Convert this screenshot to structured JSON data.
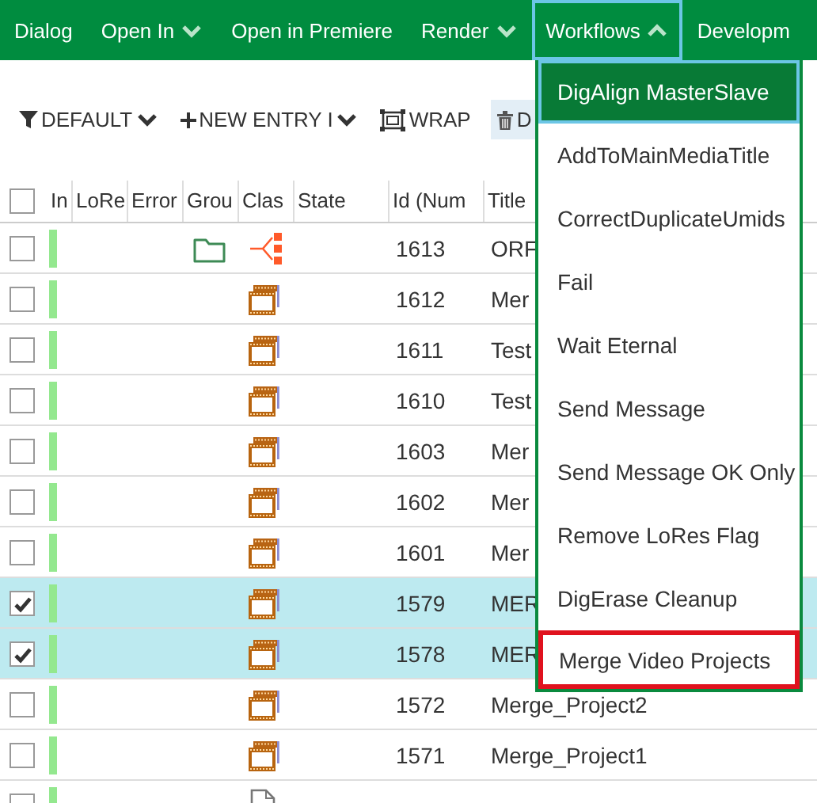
{
  "menubar": {
    "items": [
      {
        "label": "Dialog",
        "kind": "plain",
        "expanded": false
      },
      {
        "label": "Open In",
        "kind": "dropdown",
        "expanded": false
      },
      {
        "label": "Open in Premiere",
        "kind": "plain",
        "expanded": false
      },
      {
        "label": "Render",
        "kind": "dropdown",
        "expanded": false
      },
      {
        "label": "Workflows",
        "kind": "dropdown",
        "expanded": true
      },
      {
        "label": "Developm",
        "kind": "plain",
        "expanded": false
      }
    ]
  },
  "toolbar": {
    "items": [
      {
        "kind": "filter",
        "label": "DEFAULT"
      },
      {
        "kind": "new",
        "label": "NEW ENTRY I"
      },
      {
        "kind": "wrap",
        "label": "WRAP"
      },
      {
        "kind": "delete",
        "label": "D"
      }
    ]
  },
  "table": {
    "select_all": {
      "checked": false
    },
    "columns": [
      "In",
      "LoRe",
      "Error",
      "Grou",
      "Clas",
      "State",
      "Id (Num",
      "Title"
    ],
    "rows": [
      {
        "kind": "sequence",
        "group": true,
        "id": "1613",
        "title": "ORF",
        "checked": false,
        "selected": false
      },
      {
        "kind": "clip",
        "group": false,
        "id": "1612",
        "title": "Mer",
        "checked": false,
        "selected": false
      },
      {
        "kind": "clip",
        "group": false,
        "id": "1611",
        "title": "Test",
        "checked": false,
        "selected": false
      },
      {
        "kind": "clip",
        "group": false,
        "id": "1610",
        "title": "Test",
        "checked": false,
        "selected": false
      },
      {
        "kind": "clip",
        "group": false,
        "id": "1603",
        "title": "Mer",
        "checked": false,
        "selected": false
      },
      {
        "kind": "clip",
        "group": false,
        "id": "1602",
        "title": "Mer",
        "checked": false,
        "selected": false
      },
      {
        "kind": "clip",
        "group": false,
        "id": "1601",
        "title": "Mer",
        "checked": false,
        "selected": false
      },
      {
        "kind": "clip",
        "group": false,
        "id": "1579",
        "title": "MER",
        "checked": true,
        "selected": true
      },
      {
        "kind": "clip",
        "group": false,
        "id": "1578",
        "title": "MER",
        "checked": true,
        "selected": true
      },
      {
        "kind": "clip",
        "group": false,
        "id": "1572",
        "title": "Merge_Project2",
        "checked": false,
        "selected": false
      },
      {
        "kind": "clip",
        "group": false,
        "id": "1571",
        "title": "Merge_Project1",
        "checked": false,
        "selected": false
      },
      {
        "kind": "document",
        "group": false,
        "checked": false,
        "selected": false
      }
    ]
  },
  "workflows_menu": {
    "items": [
      {
        "label": "DigAlign MasterSlave",
        "selected": true,
        "outlined": false
      },
      {
        "label": "AddToMainMediaTitle",
        "selected": false,
        "outlined": false
      },
      {
        "label": "CorrectDuplicateUmids",
        "selected": false,
        "outlined": false
      },
      {
        "label": "Fail",
        "selected": false,
        "outlined": false
      },
      {
        "label": "Wait Eternal",
        "selected": false,
        "outlined": false
      },
      {
        "label": "Send Message",
        "selected": false,
        "outlined": false
      },
      {
        "label": "Send Message OK Only",
        "selected": false,
        "outlined": false
      },
      {
        "label": "Remove LoRes Flag",
        "selected": false,
        "outlined": false
      },
      {
        "label": "DigErase Cleanup",
        "selected": false,
        "outlined": false
      },
      {
        "label": "Merge Video Projects",
        "selected": false,
        "outlined": true
      }
    ]
  }
}
